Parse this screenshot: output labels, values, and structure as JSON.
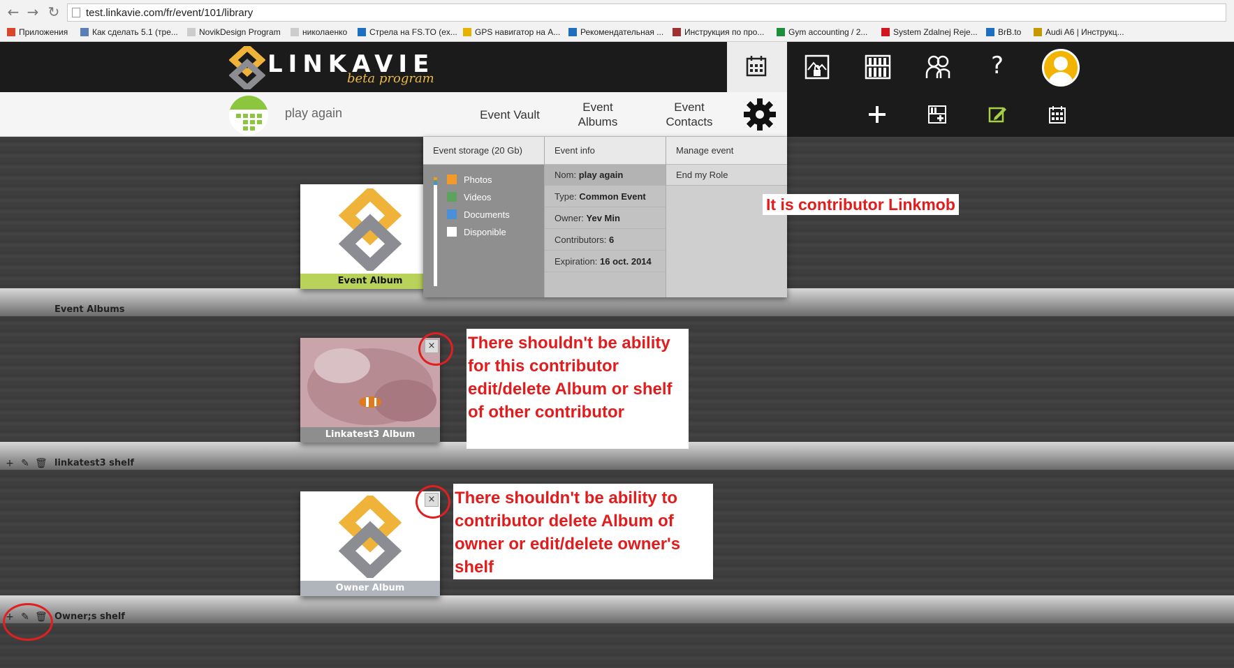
{
  "browser": {
    "url": "test.linkavie.com/fr/event/101/library",
    "bookmarks": [
      {
        "label": "Приложения",
        "color": "#d9452e"
      },
      {
        "label": "Как сделать 5.1 (тре...",
        "color": "#5a7fb7"
      },
      {
        "label": "NovikDesign Program",
        "color": "#cccccc"
      },
      {
        "label": "николаенко",
        "color": "#cccccc"
      },
      {
        "label": "Стрела на FS.TO (ex...",
        "color": "#1f6fc0"
      },
      {
        "label": "GPS навигатор на A...",
        "color": "#e7b100"
      },
      {
        "label": "Рекомендательная ...",
        "color": "#1f6fc0"
      },
      {
        "label": "Инструкция по про...",
        "color": "#a13030"
      },
      {
        "label": "Gym accounting / 2...",
        "color": "#1d8f3a"
      },
      {
        "label": "System Zdalnej Reje...",
        "color": "#d0161e"
      },
      {
        "label": "BrB.to",
        "color": "#1f6fc0"
      },
      {
        "label": "Audi A6 | Инструкц...",
        "color": "#c49a00"
      }
    ]
  },
  "header": {
    "brand": "LINKAVIE",
    "brand_sub": "beta program",
    "help_glyph": "?"
  },
  "subbar": {
    "event_name": "play again",
    "nav": {
      "vault": "Event Vault",
      "albums_line1": "Event",
      "albums_line2": "Albums",
      "contacts_line1": "Event",
      "contacts_line2": "Contacts"
    },
    "plus_glyph": "+"
  },
  "panel": {
    "storage_header": "Event storage (20 Gb)",
    "info_header": "Event info",
    "manage_header": "Manage event",
    "legend": [
      {
        "label": "Photos",
        "color": "#f39a2b"
      },
      {
        "label": "Videos",
        "color": "#5da35d"
      },
      {
        "label": "Documents",
        "color": "#4a90d9"
      },
      {
        "label": "Disponible",
        "color": "#ffffff"
      }
    ],
    "info": [
      {
        "key": "Nom:",
        "value": "play again"
      },
      {
        "key": "Type:",
        "value": "Common Event"
      },
      {
        "key": "Owner:",
        "value": "Yev Min"
      },
      {
        "key": "Contributors:",
        "value": "6"
      },
      {
        "key": "Expiration:",
        "value": "16 oct. 2014"
      }
    ],
    "manage_items": [
      "End my Role"
    ]
  },
  "shelves": [
    {
      "label": "Event Albums",
      "album": "Event Album",
      "caption_color": "#b9d35a"
    },
    {
      "label": "linkatest3 shelf",
      "album": "Linkatest3 Album",
      "caption_color": "#8e8e8e"
    },
    {
      "label": "Owner;s shelf",
      "album": "Owner Album",
      "caption_color": "#b0b4bb"
    }
  ],
  "close_glyph": "×",
  "annotations": {
    "contributor": "It is contributor Linkmob",
    "note1": [
      "There shouldn't be ability",
      "for this contributor",
      "edit/delete Album or shelf",
      "of other contributor"
    ],
    "note2": [
      "There shouldn't be ability to",
      "contributor delete Album of",
      "owner or edit/delete owner's",
      "shelf"
    ]
  }
}
